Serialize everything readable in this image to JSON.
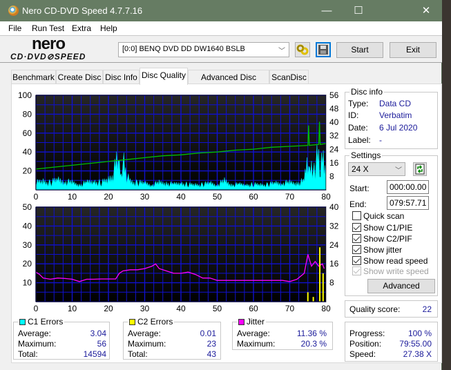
{
  "window": {
    "title": "Nero CD-DVD Speed 4.7.7.16",
    "minimize": "—",
    "maximize": "☐",
    "close": "✕"
  },
  "menu": [
    "File",
    "Run Test",
    "Extra",
    "Help"
  ],
  "toolbar": {
    "logo_top": "nero",
    "logo_bottom": "CD·DVD⊘SPEED",
    "drive": "[0:0]   BENQ DVD DD DW1640 BSLB",
    "start_label": "Start",
    "exit_label": "Exit"
  },
  "tabs": [
    {
      "label": "Benchmark",
      "active": false
    },
    {
      "label": "Create Disc",
      "active": false
    },
    {
      "label": "Disc Info",
      "active": false
    },
    {
      "label": "Disc Quality",
      "active": true
    },
    {
      "label": "Advanced Disc Quality",
      "active": false
    },
    {
      "label": "ScanDisc",
      "active": false
    }
  ],
  "disc_info": {
    "title": "Disc info",
    "type_label": "Type:",
    "type": "Data CD",
    "id_label": "ID:",
    "id": "Verbatim",
    "date_label": "Date:",
    "date": "6 Jul 2020",
    "label_label": "Label:",
    "label": "-"
  },
  "settings": {
    "title": "Settings",
    "speed": "24 X",
    "start_label": "Start:",
    "start": "000:00.00",
    "end_label": "End:",
    "end": "079:57.71",
    "quick_scan": {
      "label": "Quick scan",
      "checked": false
    },
    "show_c1": {
      "label": "Show C1/PIE",
      "checked": true
    },
    "show_c2": {
      "label": "Show C2/PIF",
      "checked": true
    },
    "show_jitter": {
      "label": "Show jitter",
      "checked": true
    },
    "show_read": {
      "label": "Show read speed",
      "checked": true
    },
    "show_write": {
      "label": "Show write speed",
      "checked": true,
      "disabled": true
    },
    "advanced_label": "Advanced"
  },
  "quality": {
    "label": "Quality score:",
    "value": "22"
  },
  "progress": {
    "progress_label": "Progress:",
    "progress": "100 %",
    "position_label": "Position:",
    "position": "79:55.00",
    "speed_label": "Speed:",
    "speed": "27.38 X"
  },
  "stats": {
    "c1": {
      "title": "C1 Errors",
      "color": "#00ffff",
      "avg_label": "Average:",
      "avg": "3.04",
      "max_label": "Maximum:",
      "max": "56",
      "total_label": "Total:",
      "total": "14594"
    },
    "c2": {
      "title": "C2 Errors",
      "color": "#ffff00",
      "avg_label": "Average:",
      "avg": "0.01",
      "max_label": "Maximum:",
      "max": "23",
      "total_label": "Total:",
      "total": "43"
    },
    "jitter": {
      "title": "Jitter",
      "color": "#ff00ff",
      "avg_label": "Average:",
      "avg": "11.36 %",
      "max_label": "Maximum:",
      "max": "20.3 %"
    }
  },
  "chart_data": [
    {
      "type": "area",
      "title": "C1 errors and read speed",
      "xlabel": "",
      "ylabel": "",
      "xlim": [
        0,
        80
      ],
      "ylim_left": [
        0,
        100
      ],
      "ylim_right": [
        0,
        56
      ],
      "x_ticks": [
        "0",
        "10",
        "20",
        "30",
        "40",
        "50",
        "60",
        "70",
        "80"
      ],
      "y_ticks_left": [
        "100",
        "80",
        "60",
        "40",
        "20"
      ],
      "y_ticks_right": [
        "56",
        "48",
        "40",
        "32",
        "24",
        "16",
        "8"
      ],
      "grid": true,
      "series": [
        {
          "name": "C1 Errors",
          "color": "#00ffff",
          "axis": "right",
          "x": [
            0,
            2,
            4,
            6,
            8,
            10,
            12,
            14,
            16,
            18,
            20,
            21,
            22,
            22.5,
            23,
            23.5,
            24,
            24.5,
            25,
            26,
            28,
            30,
            32,
            34,
            36,
            38,
            40,
            42,
            44,
            46,
            48,
            50,
            52,
            54,
            56,
            58,
            60,
            62,
            64,
            66,
            68,
            70,
            72,
            74,
            74.5,
            75,
            75.5,
            76,
            76.5,
            77,
            77.5,
            78,
            78.5,
            79,
            79.5,
            80
          ],
          "values": [
            4,
            5,
            4,
            6,
            5,
            4,
            3,
            4,
            5,
            4,
            6,
            8,
            14,
            20,
            12,
            8,
            16,
            14,
            8,
            5,
            4,
            4,
            3,
            4,
            4,
            3,
            4,
            3,
            3,
            3,
            4,
            3,
            5,
            3,
            3,
            3,
            3,
            3,
            3,
            4,
            4,
            4,
            4,
            5,
            12,
            20,
            10,
            16,
            14,
            10,
            18,
            20,
            8,
            22,
            17,
            14
          ]
        },
        {
          "name": "Read speed",
          "color": "#00c000",
          "axis": "left",
          "x": [
            0,
            5,
            10,
            15,
            20,
            25,
            30,
            35,
            40,
            45,
            50,
            55,
            60,
            65,
            70,
            75,
            75.2,
            75.4,
            78,
            78.2,
            78.4,
            80
          ],
          "values": [
            22,
            24,
            26,
            28,
            30,
            32,
            34,
            36,
            37,
            39,
            40,
            42,
            43,
            45,
            46,
            47,
            68,
            47,
            48,
            72,
            48,
            49
          ]
        }
      ]
    },
    {
      "type": "line",
      "title": "C2 errors and jitter",
      "xlabel": "",
      "ylabel": "",
      "xlim": [
        0,
        80
      ],
      "ylim_left": [
        0,
        50
      ],
      "ylim_right": [
        0,
        40
      ],
      "x_ticks": [
        "0",
        "10",
        "20",
        "30",
        "40",
        "50",
        "60",
        "70",
        "80"
      ],
      "y_ticks_left": [
        "50",
        "40",
        "30",
        "20",
        "10"
      ],
      "y_ticks_right": [
        "40",
        "32",
        "24",
        "16",
        "8"
      ],
      "grid": true,
      "series": [
        {
          "name": "Jitter",
          "color": "#ff00ff",
          "axis": "right",
          "x": [
            0,
            1,
            2,
            4,
            6,
            8,
            10,
            12,
            14,
            16,
            18,
            20,
            22,
            23,
            24,
            26,
            28,
            30,
            32,
            33,
            34,
            36,
            38,
            40,
            42,
            44,
            46,
            48,
            50,
            52,
            54,
            56,
            58,
            60,
            62,
            64,
            66,
            68,
            70,
            72,
            74,
            75,
            76,
            77,
            78,
            79,
            79.5
          ],
          "values": [
            12.5,
            11.5,
            10,
            9.5,
            10,
            9.8,
            9.5,
            8.5,
            9.5,
            9.5,
            9.6,
            9.6,
            9.6,
            12,
            13,
            13.5,
            13.5,
            14,
            15,
            16,
            14,
            13,
            12,
            12,
            12.5,
            11.5,
            10,
            10,
            9,
            9,
            9,
            9,
            9,
            9,
            9,
            9,
            9,
            9,
            8.5,
            9.5,
            12,
            20,
            15,
            17,
            15,
            16,
            14
          ]
        },
        {
          "name": "C2 Errors",
          "color": "#ffff00",
          "axis": "right",
          "x": [
            75,
            76.5,
            78.3,
            79.2
          ],
          "values": [
            4,
            2,
            23,
            12
          ]
        }
      ]
    }
  ]
}
